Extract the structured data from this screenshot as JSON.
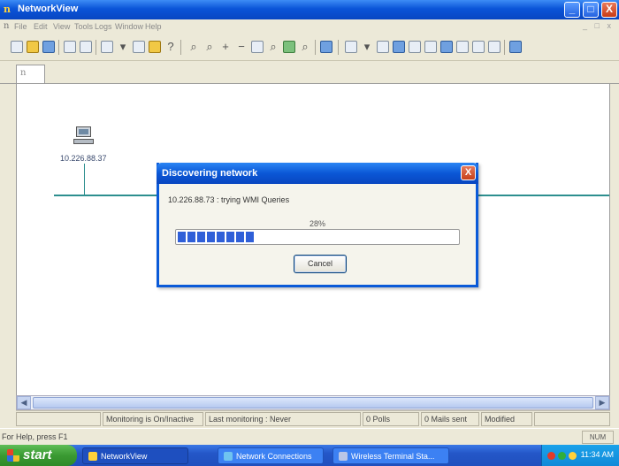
{
  "window": {
    "title": "NetworkView",
    "minimize": "_",
    "maximize": "□",
    "close": "X"
  },
  "menu": {
    "items": [
      "File",
      "Edit",
      "View",
      "Tools",
      "Logs",
      "Window",
      "Help"
    ],
    "mdi_controls": "_ □ x"
  },
  "map": {
    "device_label": "10.226.88.37"
  },
  "dialog": {
    "title": "Discovering network",
    "close": "X",
    "message": "10.226.88.73 : trying WMI Queries",
    "percent_text": "28%",
    "progress": 0.28,
    "cancel_label": "Cancel"
  },
  "monitor_bar": {
    "status": "Monitoring is On/Inactive",
    "last": "Last monitoring : Never",
    "polls": "0 Polls",
    "mails": "0 Mails sent",
    "modified": "Modified"
  },
  "statusbar": {
    "help": "For Help, press F1",
    "num": "NUM"
  },
  "taskbar": {
    "start": "start",
    "tasks": [
      "NetworkView",
      "Network Connections",
      "Wireless Terminal Sta..."
    ],
    "clock": "11:34 AM"
  },
  "colors": {
    "titlebar": "#0a54d8",
    "start_button": "#3a9a32",
    "network_line": "#2d8f8f",
    "progress": "#2f5fd8"
  }
}
